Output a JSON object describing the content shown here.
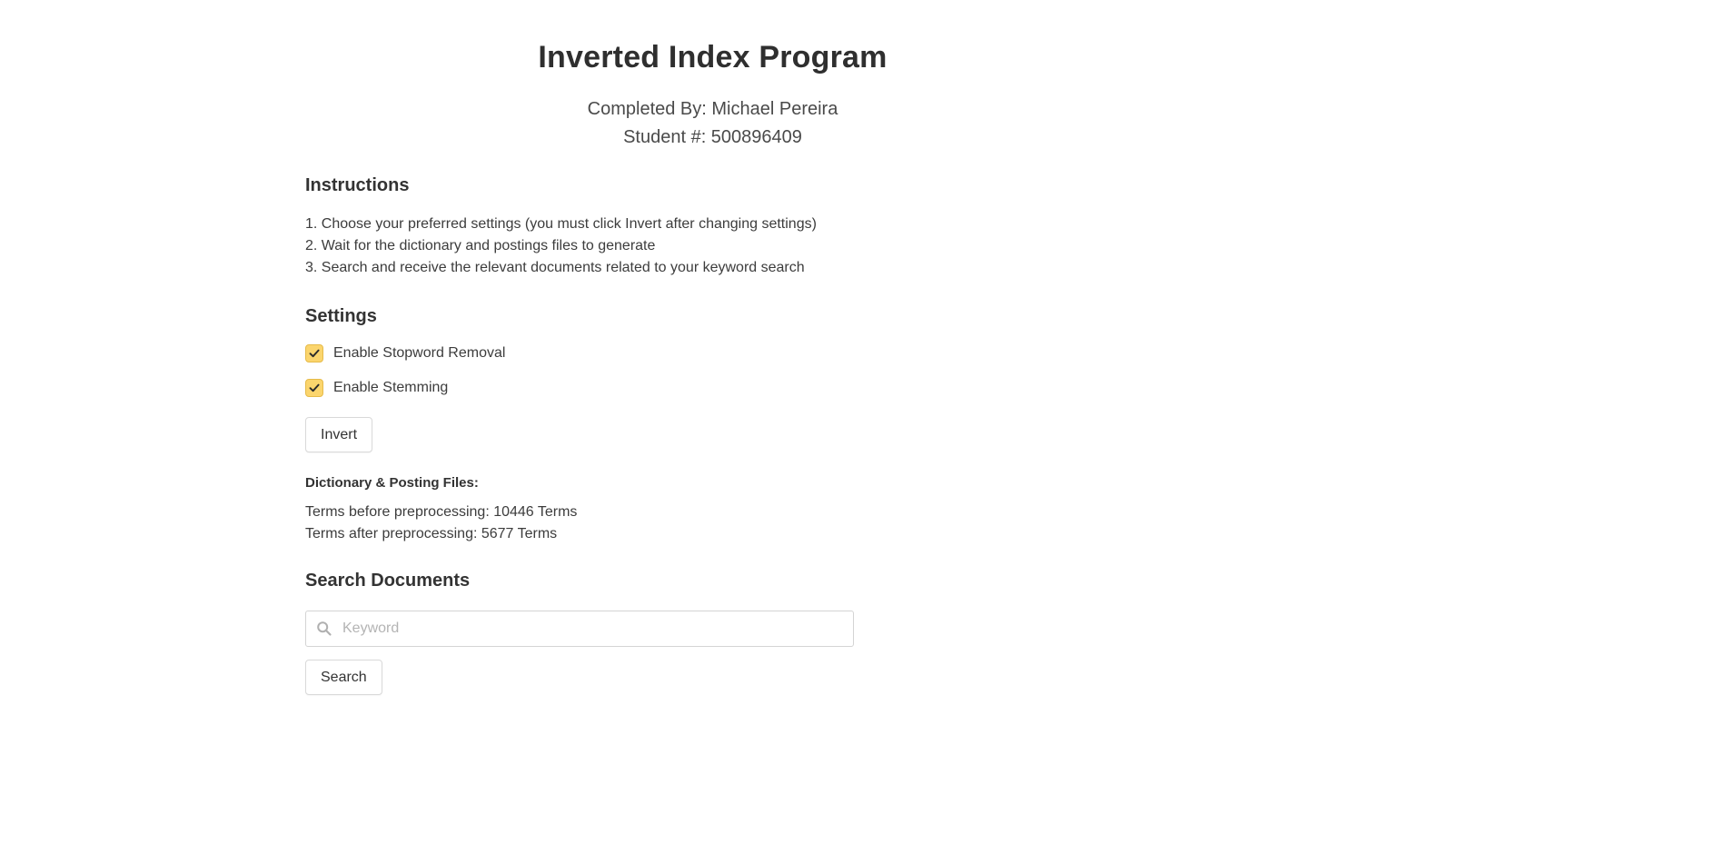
{
  "header": {
    "title": "Inverted Index Program",
    "completed_by": "Completed By: Michael Pereira",
    "student_number": "Student #: 500896409"
  },
  "instructions": {
    "heading": "Instructions",
    "steps": [
      "1. Choose your preferred settings (you must click Invert after changing settings)",
      "2. Wait for the dictionary and postings files to generate",
      "3. Search and receive the relevant documents related to your keyword search"
    ]
  },
  "settings": {
    "heading": "Settings",
    "options": [
      {
        "label": "Enable Stopword Removal",
        "checked": true
      },
      {
        "label": "Enable Stemming",
        "checked": true
      }
    ],
    "invert_label": "Invert",
    "checkbox_color": "#fbd56d"
  },
  "files": {
    "heading": "Dictionary & Posting Files:",
    "terms_before": "Terms before preprocessing: 10446 Terms",
    "terms_after": "Terms after preprocessing: 5677 Terms"
  },
  "search": {
    "heading": "Search Documents",
    "placeholder": "Keyword",
    "value": "",
    "icon": "search-icon",
    "button_label": "Search"
  }
}
